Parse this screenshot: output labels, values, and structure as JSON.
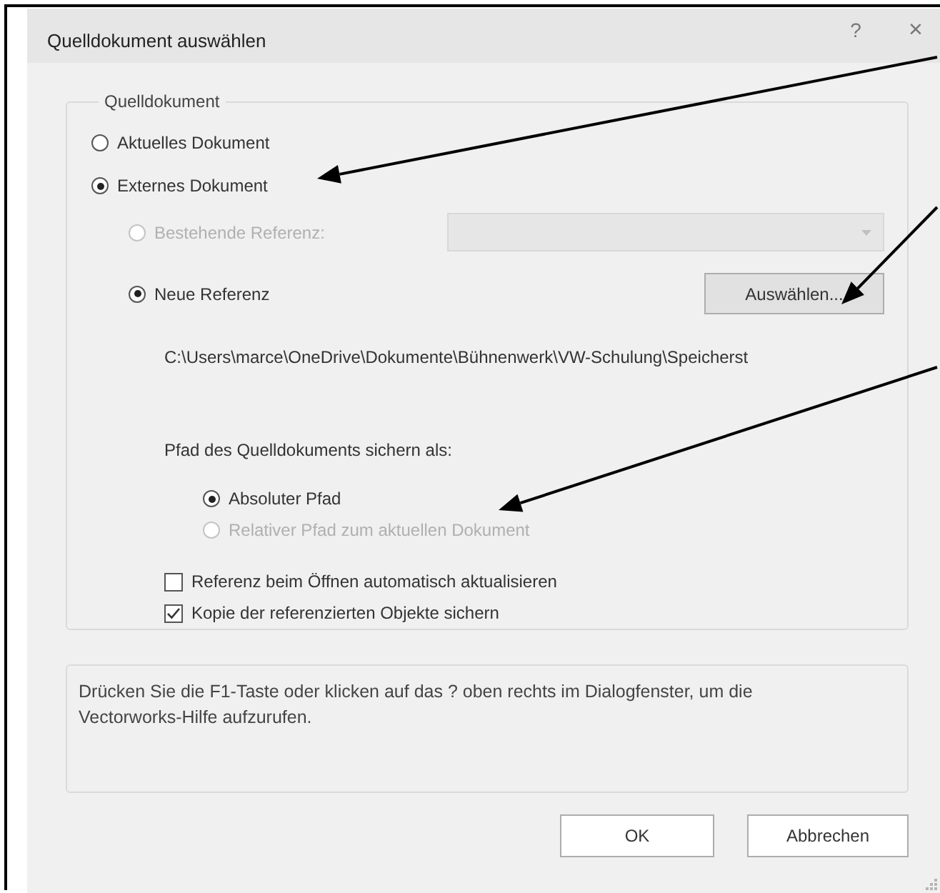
{
  "window": {
    "title": "Quelldokument auswählen",
    "help_button": "?",
    "close_button": "×"
  },
  "source_group": {
    "legend": "Quelldokument",
    "options": [
      {
        "label": "Aktuelles Dokument",
        "selected": false,
        "disabled": false
      },
      {
        "label": "Externes Dokument",
        "selected": true,
        "disabled": false
      }
    ],
    "reference_options": [
      {
        "kind": "dropdown",
        "label": "Bestehende Referenz:",
        "selected": false,
        "disabled": true
      },
      {
        "kind": "button",
        "label": "Neue Referenz",
        "selected": true,
        "disabled": false,
        "button": "Auswählen..."
      }
    ],
    "path": "C:\\Users\\marce\\OneDrive\\Dokumente\\Bühnenwerk\\VW-Schulung\\Speicherst",
    "save_path_label": "Pfad des Quelldokuments sichern als:",
    "path_modes": [
      {
        "label": "Absoluter Pfad",
        "selected": true,
        "disabled": false
      },
      {
        "label": "Relativer Pfad zum aktuellen Dokument",
        "selected": false,
        "disabled": true
      }
    ],
    "checkboxes": [
      {
        "label": "Referenz beim Öffnen automatisch aktualisieren",
        "checked": false
      },
      {
        "label": "Kopie der referenzierten Objekte sichern",
        "checked": true
      }
    ]
  },
  "help_text": "Drücken Sie die F1-Taste oder klicken auf das ? oben rechts im Dialogfenster, um die Vectorworks-Hilfe aufzurufen.",
  "buttons": [
    "OK",
    "Abbrechen"
  ]
}
